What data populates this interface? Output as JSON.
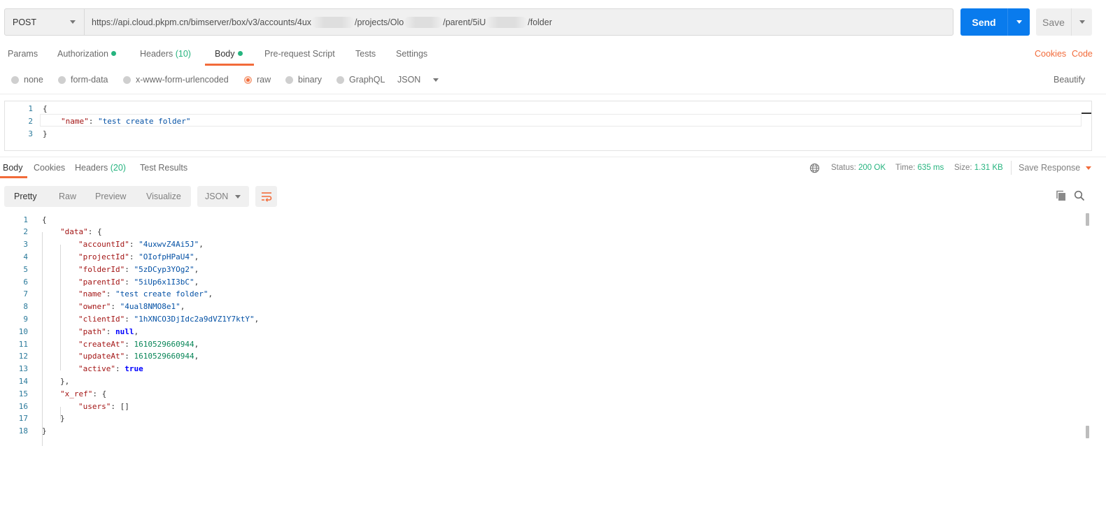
{
  "request": {
    "method": "POST",
    "url_segments": [
      "https://api.cloud.pkpm.cn/bimserver/box/v3/accounts/4ux",
      "/projects/Olo",
      "/parent/5iU",
      "/folder"
    ],
    "send_label": "Send",
    "save_label": "Save"
  },
  "request_tabs": {
    "params": "Params",
    "authorization": "Authorization",
    "headers": "Headers",
    "headers_count": "(10)",
    "body": "Body",
    "prerequest": "Pre-request Script",
    "tests": "Tests",
    "settings": "Settings",
    "cookies": "Cookies",
    "code": "Code"
  },
  "body_options": {
    "none": "none",
    "form_data": "form-data",
    "urlencoded": "x-www-form-urlencoded",
    "raw": "raw",
    "binary": "binary",
    "graphql": "GraphQL",
    "json": "JSON",
    "beautify": "Beautify",
    "selected": "raw"
  },
  "request_body": {
    "line_numbers": [
      "1",
      "2",
      "3"
    ],
    "open_brace": "{",
    "key": "\"name\"",
    "colon": ": ",
    "value": "\"test create folder\"",
    "close_brace": "}"
  },
  "response_tabs": {
    "body": "Body",
    "cookies": "Cookies",
    "headers": "Headers",
    "headers_count": "(20)",
    "test_results": "Test Results",
    "status_label": "Status:",
    "status_value": "200 OK",
    "time_label": "Time:",
    "time_value": "635 ms",
    "size_label": "Size:",
    "size_value": "1.31 KB",
    "save_response": "Save Response"
  },
  "response_format": {
    "pretty": "Pretty",
    "raw": "Raw",
    "preview": "Preview",
    "visualize": "Visualize",
    "language": "JSON"
  },
  "response_lines": [
    {
      "n": "1",
      "parts": [
        [
          "p",
          "{"
        ]
      ]
    },
    {
      "n": "2",
      "parts": [
        [
          "k",
          "\"data\""
        ],
        [
          "p",
          ": {"
        ]
      ]
    },
    {
      "n": "3",
      "parts": [
        [
          "k",
          "\"accountId\""
        ],
        [
          "p",
          ": "
        ],
        [
          "s",
          "\"4uxwvZ4Ai5J\""
        ],
        [
          "p",
          ","
        ]
      ]
    },
    {
      "n": "4",
      "parts": [
        [
          "k",
          "\"projectId\""
        ],
        [
          "p",
          ": "
        ],
        [
          "s",
          "\"OIofpHPaU4\""
        ],
        [
          "p",
          ","
        ]
      ]
    },
    {
      "n": "5",
      "parts": [
        [
          "k",
          "\"folderId\""
        ],
        [
          "p",
          ": "
        ],
        [
          "s",
          "\"5zDCyp3YOg2\""
        ],
        [
          "p",
          ","
        ]
      ]
    },
    {
      "n": "6",
      "parts": [
        [
          "k",
          "\"parentId\""
        ],
        [
          "p",
          ": "
        ],
        [
          "s",
          "\"5iUp6x1I3bC\""
        ],
        [
          "p",
          ","
        ]
      ]
    },
    {
      "n": "7",
      "parts": [
        [
          "k",
          "\"name\""
        ],
        [
          "p",
          ": "
        ],
        [
          "s",
          "\"test create folder\""
        ],
        [
          "p",
          ","
        ]
      ]
    },
    {
      "n": "8",
      "parts": [
        [
          "k",
          "\"owner\""
        ],
        [
          "p",
          ": "
        ],
        [
          "s",
          "\"4ual8NMO8e1\""
        ],
        [
          "p",
          ","
        ]
      ]
    },
    {
      "n": "9",
      "parts": [
        [
          "k",
          "\"clientId\""
        ],
        [
          "p",
          ": "
        ],
        [
          "s",
          "\"1hXNCO3DjIdc2a9dVZ1Y7ktY\""
        ],
        [
          "p",
          ","
        ]
      ]
    },
    {
      "n": "10",
      "parts": [
        [
          "k",
          "\"path\""
        ],
        [
          "p",
          ": "
        ],
        [
          "b",
          "null"
        ],
        [
          "p",
          ","
        ]
      ]
    },
    {
      "n": "11",
      "parts": [
        [
          "k",
          "\"createAt\""
        ],
        [
          "p",
          ": "
        ],
        [
          "n",
          "1610529660944"
        ],
        [
          "p",
          ","
        ]
      ]
    },
    {
      "n": "12",
      "parts": [
        [
          "k",
          "\"updateAt\""
        ],
        [
          "p",
          ": "
        ],
        [
          "n",
          "1610529660944"
        ],
        [
          "p",
          ","
        ]
      ]
    },
    {
      "n": "13",
      "parts": [
        [
          "k",
          "\"active\""
        ],
        [
          "p",
          ": "
        ],
        [
          "b",
          "true"
        ]
      ]
    },
    {
      "n": "14",
      "parts": [
        [
          "p",
          "},"
        ]
      ]
    },
    {
      "n": "15",
      "parts": [
        [
          "k",
          "\"x_ref\""
        ],
        [
          "p",
          ": {"
        ]
      ]
    },
    {
      "n": "16",
      "parts": [
        [
          "k",
          "\"users\""
        ],
        [
          "p",
          ": []"
        ]
      ]
    },
    {
      "n": "17",
      "parts": [
        [
          "p",
          "}"
        ]
      ]
    },
    {
      "n": "18",
      "parts": [
        [
          "p",
          "}"
        ]
      ]
    }
  ],
  "response_indent": [
    0,
    1,
    2,
    2,
    2,
    2,
    2,
    2,
    2,
    2,
    2,
    2,
    2,
    1,
    1,
    2,
    1,
    0
  ],
  "icons": {
    "method_caret": "chevron-down-icon",
    "send_caret": "chevron-down-icon",
    "save_caret": "chevron-down-icon",
    "globe": "globe-icon",
    "wrap": "wrap-lines-icon",
    "copy": "copy-icon",
    "search": "search-icon"
  },
  "colors": {
    "accent": "#f26b3a",
    "send": "#097bed",
    "success": "#26b47f",
    "json_key": "#a31515",
    "json_string": "#0451a5",
    "json_number": "#098658",
    "json_keyword": "#0000ff"
  }
}
